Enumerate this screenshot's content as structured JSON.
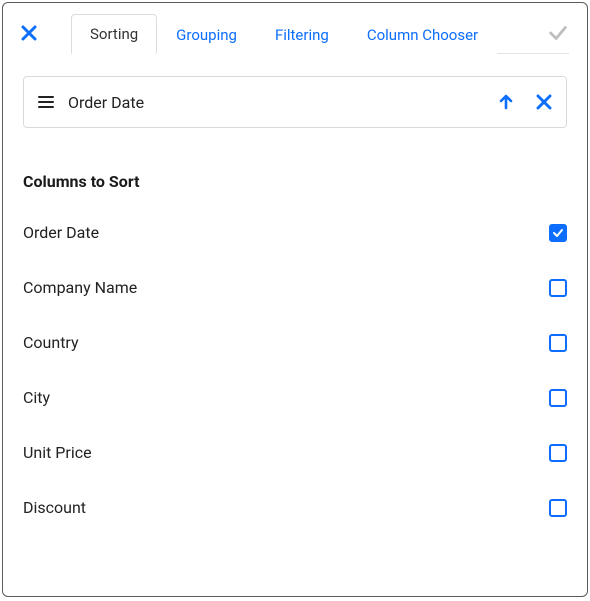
{
  "tabs": {
    "sorting": "Sorting",
    "grouping": "Grouping",
    "filtering": "Filtering",
    "column_chooser": "Column Chooser"
  },
  "active_tab": "sorting",
  "active_sort": {
    "label": "Order Date",
    "direction": "asc"
  },
  "section_heading": "Columns to Sort",
  "columns": [
    {
      "label": "Order Date",
      "checked": true
    },
    {
      "label": "Company Name",
      "checked": false
    },
    {
      "label": "Country",
      "checked": false
    },
    {
      "label": "City",
      "checked": false
    },
    {
      "label": "Unit Price",
      "checked": false
    },
    {
      "label": "Discount",
      "checked": false
    }
  ],
  "colors": {
    "accent": "#0d6efd"
  }
}
